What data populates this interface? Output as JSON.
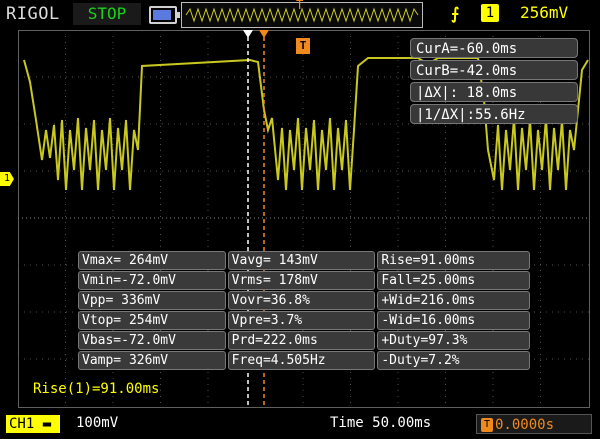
{
  "topbar": {
    "brand": "RIGOL",
    "run_state": "STOP",
    "trigger_source": "1",
    "trigger_level": "256mV"
  },
  "screen": {
    "channel_marker": "1",
    "cursor_marker": "T",
    "cursor_readouts": [
      "CurA=-60.0ms",
      "CurB=-42.0ms",
      "|ΔX|: 18.0ms",
      "|1/ΔX|:55.6Hz"
    ]
  },
  "measurements": {
    "rows": [
      [
        "Vmax= 264mV",
        "Vavg= 143mV",
        "Rise=91.00ms"
      ],
      [
        "Vmin=-72.0mV",
        "Vrms= 178mV",
        "Fall=25.00ms"
      ],
      [
        "Vpp= 336mV",
        "Vovr=36.8%",
        "+Wid=216.0ms"
      ],
      [
        "Vtop= 254mV",
        "Vpre=3.7%",
        "-Wid=16.00ms"
      ],
      [
        "Vbas=-72.0mV",
        "Prd=222.0ms",
        "+Duty=97.3%"
      ],
      [
        "Vamp= 326mV",
        "Freq=4.505Hz",
        "-Duty=7.2%"
      ]
    ],
    "rise_readout": "Rise(1)=91.00ms"
  },
  "bottombar": {
    "ch1_label": "CH1",
    "ch1_scale": "100mV",
    "timebase": "Time 50.00ms",
    "trigger_offset": "0.0000s",
    "trigger_offset_icon": "T"
  },
  "colors": {
    "trace": "#c8c820",
    "cursor_a": "#ffffff",
    "cursor_b": "#f08a1c",
    "grid": "#505050",
    "status_green": "#19d219"
  },
  "icons": [
    "battery-icon",
    "rising-edge-icon",
    "trigger-marker-icon"
  ]
}
